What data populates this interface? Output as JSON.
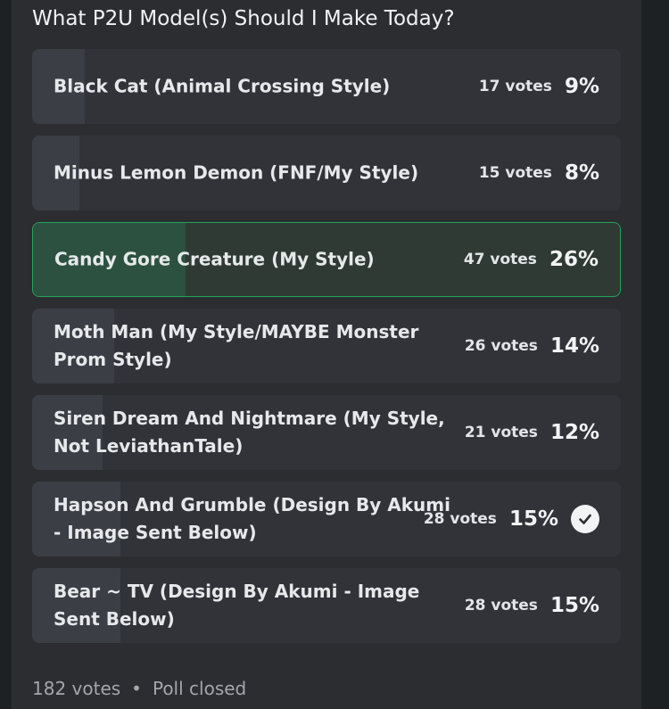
{
  "poll": {
    "question": "What P2U Model(s) Should I Make Today?",
    "answers": [
      {
        "label": "Black Cat (Animal Crossing Style)",
        "votes": "17 votes",
        "percent": "9%",
        "fraction": 0.09,
        "selected": false
      },
      {
        "label": "Minus Lemon Demon (FNF/My Style)",
        "votes": "15 votes",
        "percent": "8%",
        "fraction": 0.08,
        "selected": false
      },
      {
        "label": "Candy Gore Creature (My Style)",
        "votes": "47 votes",
        "percent": "26%",
        "fraction": 0.26,
        "selected": true
      },
      {
        "label": "Moth Man (My Style/MAYBE Monster Prom Style)",
        "votes": "26 votes",
        "percent": "14%",
        "fraction": 0.14,
        "selected": false
      },
      {
        "label": "Siren Dream And Nightmare (My Style, Not LeviathanTale)",
        "votes": "21 votes",
        "percent": "12%",
        "fraction": 0.12,
        "selected": false
      },
      {
        "label": "Hapson And Grumble (Design By Akumi - Image Sent Below)",
        "votes": "28 votes",
        "percent": "15%",
        "fraction": 0.15,
        "selected": false,
        "checked": true
      },
      {
        "label": "Bear ~ TV (Design By Akumi - Image Sent Below)",
        "votes": "28 votes",
        "percent": "15%",
        "fraction": 0.15,
        "selected": false
      }
    ],
    "total_votes": "182 votes",
    "separator": "•",
    "status": "Poll closed",
    "colors": {
      "accent_green": "#23a559",
      "checkmark_bg": "#f2f3f5"
    }
  }
}
